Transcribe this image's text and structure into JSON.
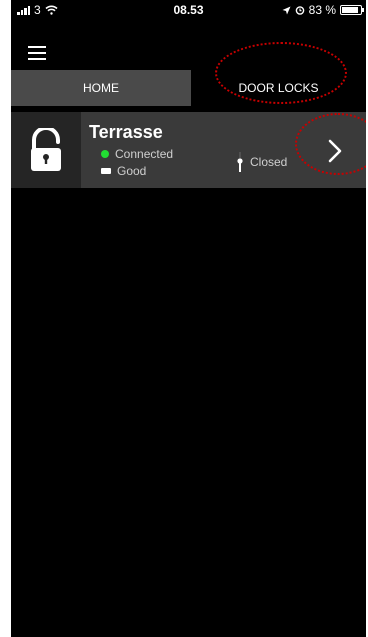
{
  "status_bar": {
    "carrier": "3",
    "time": "08.53",
    "battery": "83 %"
  },
  "tabs": [
    {
      "label": "HOME"
    },
    {
      "label": "DOOR LOCKS"
    }
  ],
  "lock": {
    "name": "Terrasse",
    "connection": "Connected",
    "battery_status": "Good",
    "door_state": "Closed"
  },
  "colors": {
    "connected_dot": "#22dd33",
    "annotation": "#c80000"
  },
  "icons": [
    "hamburger-icon",
    "padlock-open-icon",
    "battery-icon",
    "door-sensor-icon",
    "chevron-right-icon"
  ]
}
